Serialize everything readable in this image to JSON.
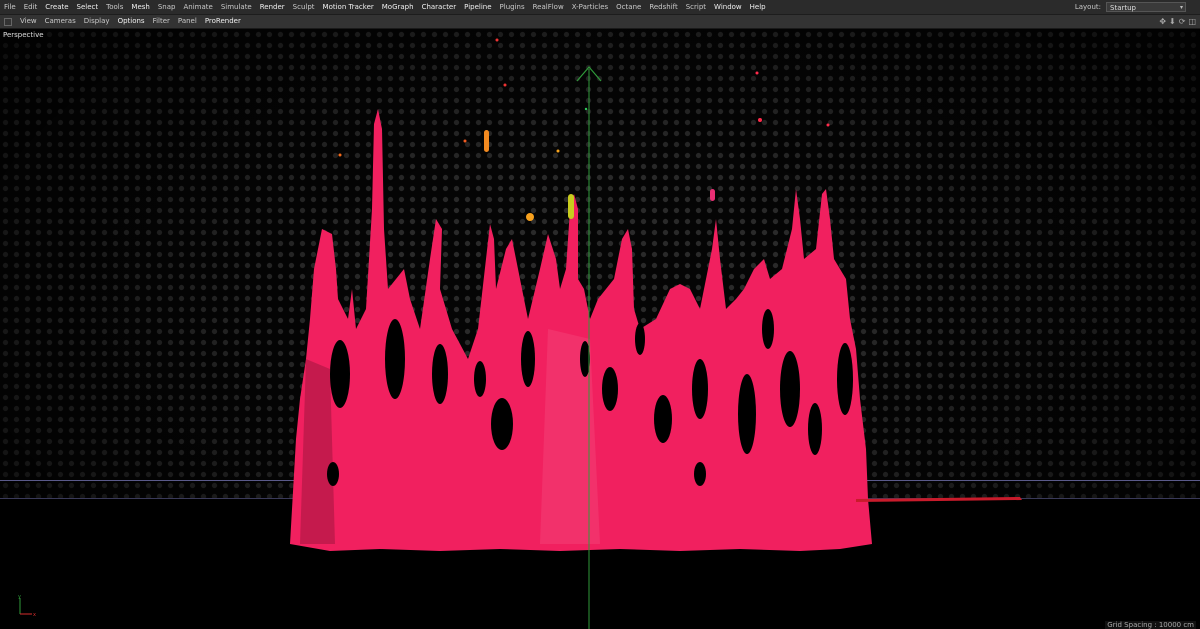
{
  "menubar": {
    "items": [
      {
        "label": "File",
        "bright": false
      },
      {
        "label": "Edit",
        "bright": false
      },
      {
        "label": "Create",
        "bright": true
      },
      {
        "label": "Select",
        "bright": true
      },
      {
        "label": "Tools",
        "bright": false
      },
      {
        "label": "Mesh",
        "bright": true
      },
      {
        "label": "Snap",
        "bright": false
      },
      {
        "label": "Animate",
        "bright": false
      },
      {
        "label": "Simulate",
        "bright": false
      },
      {
        "label": "Render",
        "bright": true
      },
      {
        "label": "Sculpt",
        "bright": false
      },
      {
        "label": "Motion Tracker",
        "bright": true
      },
      {
        "label": "MoGraph",
        "bright": true
      },
      {
        "label": "Character",
        "bright": true
      },
      {
        "label": "Pipeline",
        "bright": true
      },
      {
        "label": "Plugins",
        "bright": false
      },
      {
        "label": "RealFlow",
        "bright": false
      },
      {
        "label": "X-Particles",
        "bright": false
      },
      {
        "label": "Octane",
        "bright": false
      },
      {
        "label": "Redshift",
        "bright": false
      },
      {
        "label": "Script",
        "bright": false
      },
      {
        "label": "Window",
        "bright": true
      },
      {
        "label": "Help",
        "bright": true
      }
    ],
    "layout_label": "Layout:",
    "layout_value": "Startup"
  },
  "viewbar": {
    "items": [
      {
        "label": "View",
        "bright": false
      },
      {
        "label": "Cameras",
        "bright": false
      },
      {
        "label": "Display",
        "bright": false
      },
      {
        "label": "Options",
        "bright": true
      },
      {
        "label": "Filter",
        "bright": false
      },
      {
        "label": "Panel",
        "bright": false
      },
      {
        "label": "ProRender",
        "bright": true
      }
    ]
  },
  "viewport": {
    "label": "Perspective",
    "grid_spacing": "Grid Spacing : 10000 cm",
    "y_axis_color": "#2f9a3a",
    "x_axis_color": "#d62d2d"
  }
}
